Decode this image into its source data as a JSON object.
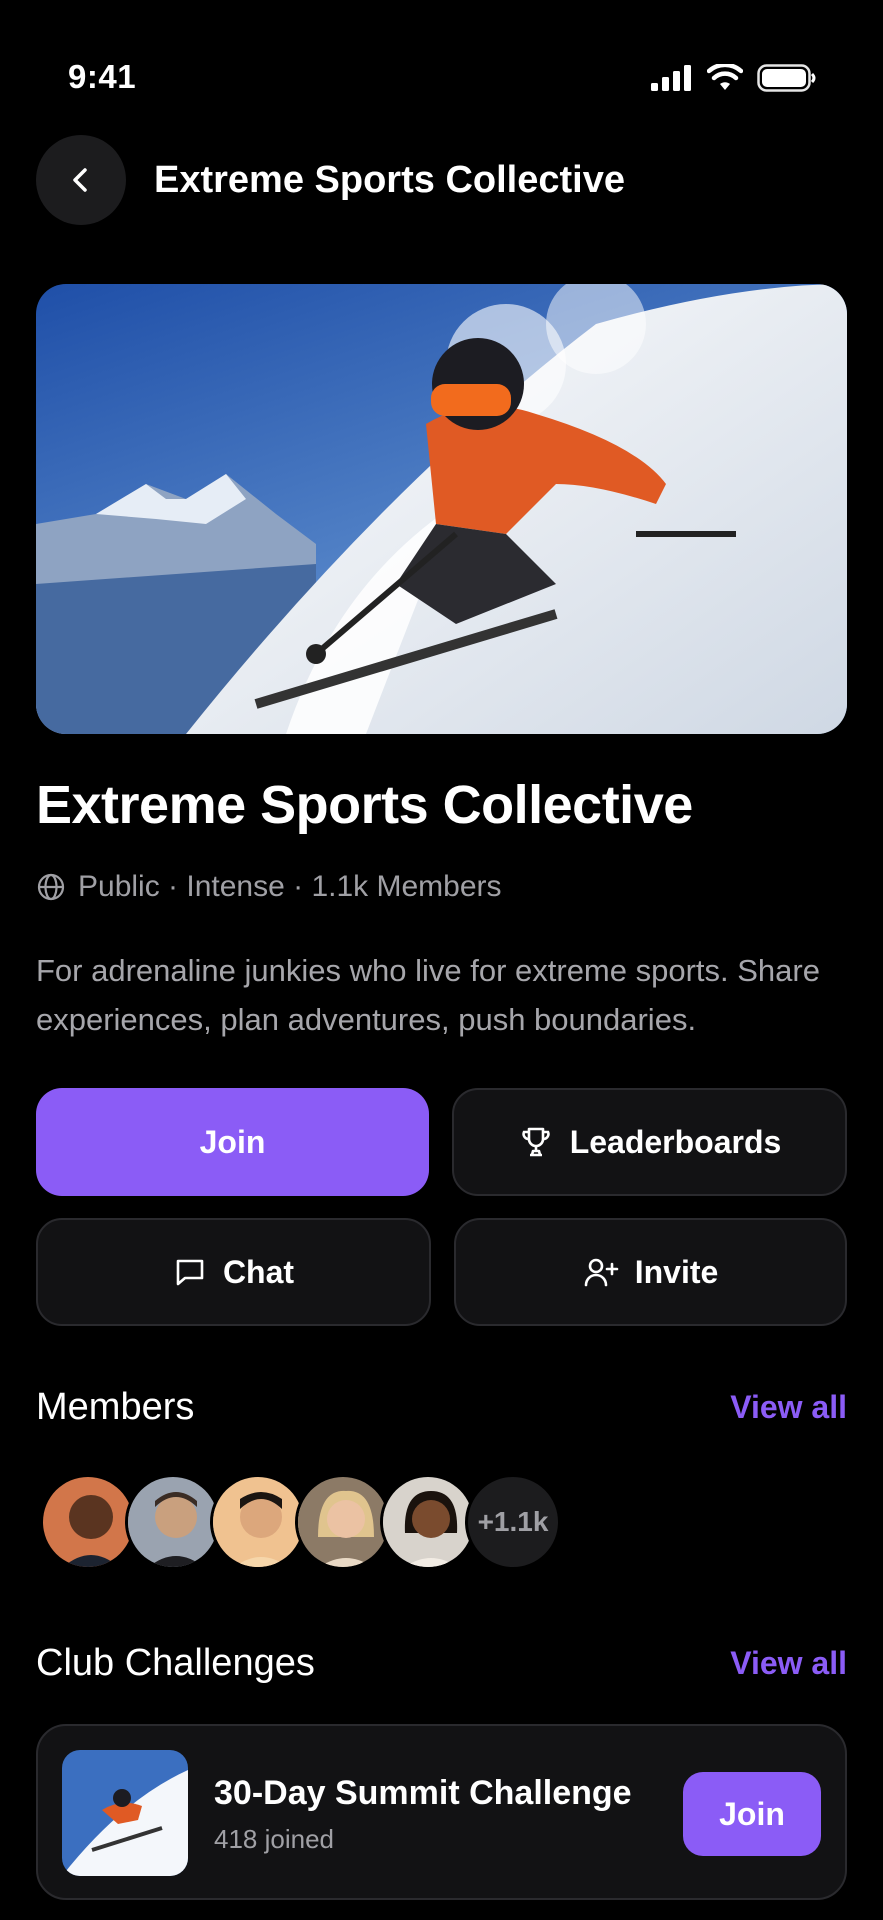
{
  "status_bar": {
    "time": "9:41"
  },
  "header": {
    "title": "Extreme Sports Collective"
  },
  "club": {
    "title": "Extreme Sports Collective",
    "meta": "Public · Intense · 1.1k Members",
    "description": "For adrenaline junkies who live for extreme sports. Share experiences, plan adventures, push boundaries."
  },
  "actions": {
    "join_label": "Join",
    "leaderboards_label": "Leaderboards",
    "chat_label": "Chat",
    "invite_label": "Invite"
  },
  "members": {
    "title": "Members",
    "view_all": "View all",
    "more_count": "+1.1k"
  },
  "challenges": {
    "title": "Club Challenges",
    "view_all": "View all",
    "items": [
      {
        "name": "30-Day Summit Challenge",
        "joined": "418 joined",
        "join_label": "Join"
      }
    ]
  },
  "colors": {
    "accent": "#8b5cf6",
    "background": "#000000",
    "card": "#121214",
    "muted_text": "#a0a0a5"
  }
}
